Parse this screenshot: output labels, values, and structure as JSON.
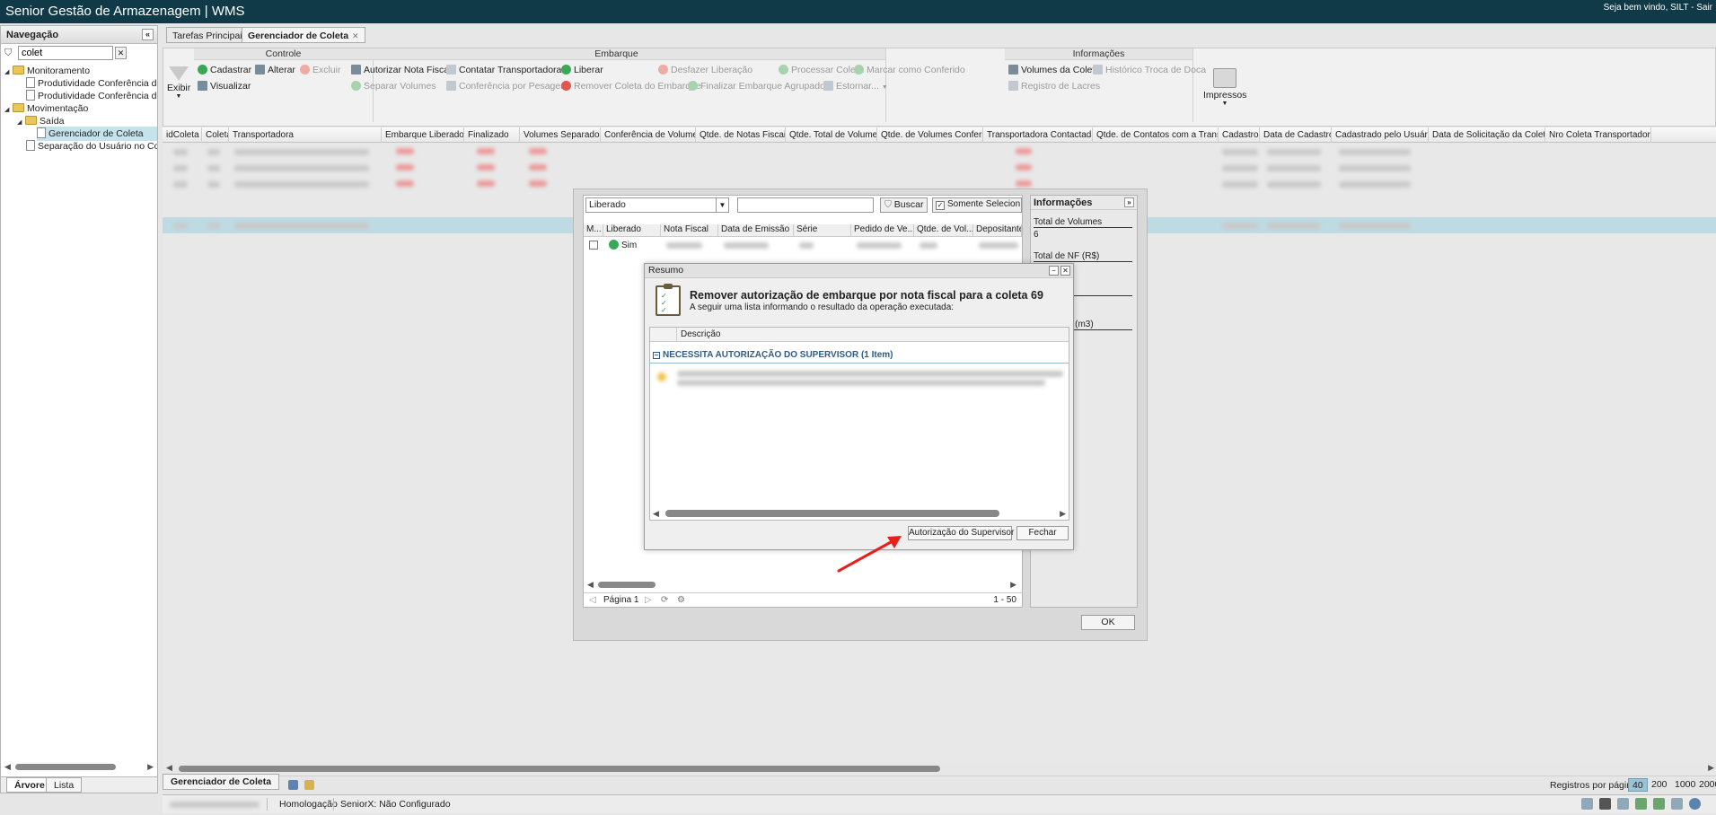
{
  "app": {
    "title": "Senior Gestão de Armazenagem | WMS",
    "welcome": "Seja bem vindo, SILT - Sair"
  },
  "nav": {
    "title": "Navegação",
    "filter_value": "colet",
    "clear": "✕",
    "collapse": "«",
    "items": [
      {
        "label": "Monitoramento",
        "kind": "folder",
        "arrow": "◢"
      },
      {
        "label": "Produtividade Conferência de Notas",
        "kind": "page"
      },
      {
        "label": "Produtividade Conferência de Volumes",
        "kind": "page"
      },
      {
        "label": "Movimentação",
        "kind": "folder",
        "arrow": "◢"
      },
      {
        "label": "Saída",
        "kind": "folder",
        "arrow": "◢"
      },
      {
        "label": "Gerenciador de Coleta",
        "kind": "page"
      },
      {
        "label": "Separação do Usuário no Coletor",
        "kind": "page"
      }
    ],
    "tabs": [
      "Árvore",
      "Lista"
    ]
  },
  "tabs": [
    {
      "label": "Tarefas Principais"
    },
    {
      "label": "Gerenciador de Coleta",
      "close": "✕"
    }
  ],
  "ribbon": {
    "exibir": "Exibir",
    "groups": {
      "controle": "Controle",
      "embarque": "Embarque",
      "informacoes": "Informações"
    },
    "controle": {
      "cadastrar": "Cadastrar",
      "alterar": "Alterar",
      "excluir": "Excluir",
      "visualizar": "Visualizar"
    },
    "embarque": {
      "autorizar_nf": "Autorizar Nota Fiscal",
      "contatar": "Contatar Transportadora",
      "liberar": "Liberar",
      "desfazer": "Desfazer Liberação",
      "processar": "Processar Coleta",
      "marcar": "Marcar como Conferido",
      "separar": "Separar Volumes",
      "conferencia_peso": "Conferência por Pesagem",
      "remover": "Remover Coleta do Embarque",
      "finalizar": "Finalizar Embarque Agrupado",
      "estornar": "Estornar..."
    },
    "informacoes": {
      "volumes": "Volumes da Coleta",
      "historico": "Histórico Troca de Doca",
      "registro": "Registro de Lacres"
    },
    "impressos": "Impressos"
  },
  "grid": {
    "columns": [
      "idColeta",
      "Coleta",
      "Transportadora",
      "Embarque Liberado",
      "Finalizado",
      "Volumes Separados",
      "Conferência de Volume",
      "Qtde. de Notas Fiscais",
      "Qtde. Total de Volumes",
      "Qtde. de Volumes Conferidos",
      "Transportadora Contactada",
      "Qtde. de Contatos com a Transportad...",
      "Cadastro",
      "Data de Cadastro",
      "Cadastrado pelo Usuário",
      "Data de Solicitação da Coleta",
      "Nro Coleta Transportadora"
    ]
  },
  "pager": {
    "rpp_label": "Registros por página:",
    "options": [
      "40",
      "200",
      "1000",
      "2000"
    ],
    "selected": "40"
  },
  "bottom_tab": "Gerenciador de Coleta",
  "status": {
    "env": "Homologação",
    "seniorx": "SeniorX: Não Configurado"
  },
  "back_dialog": {
    "status_select": "Liberado",
    "caret": "▼",
    "buscar": "Buscar",
    "somente": "Somente Selecion...",
    "check": "✓",
    "columns": [
      "M...",
      "Liberado",
      "Nota Fiscal",
      "Data de Emissão",
      "Série",
      "Pedido de Ve...",
      "Qtde. de Vol...",
      "Depositante"
    ],
    "row_liberado": "Sim",
    "page_label": "Página 1",
    "range": "1 - 50",
    "info": {
      "title": "Informações",
      "expand": "»",
      "total_volumes_label": "Total de Volumes",
      "total_volumes_value": "6",
      "total_nf_label": "Total de NF (R$)",
      "peso_label": "Peso (kg)",
      "cubagem_label": "Cubagem (m3)"
    },
    "ok": "OK"
  },
  "resumo": {
    "title": "Resumo",
    "heading": "Remover autorização de embarque por nota fiscal para a coleta 69",
    "subheading": "A seguir uma lista informando o resultado da operação executada:",
    "col_descricao": "Descrição",
    "group": "NECESSITA AUTORIZAÇÃO DO SUPERVISOR (1 Item)",
    "group_toggle": "−",
    "btn_supervisor": "Autorização do Supervisor",
    "btn_fechar": "Fechar",
    "min": "−",
    "close": "✕"
  },
  "colors": {
    "topbar": "#103a47",
    "selected_row": "#bedbe4",
    "annotation_arrow": "#e8201c"
  }
}
